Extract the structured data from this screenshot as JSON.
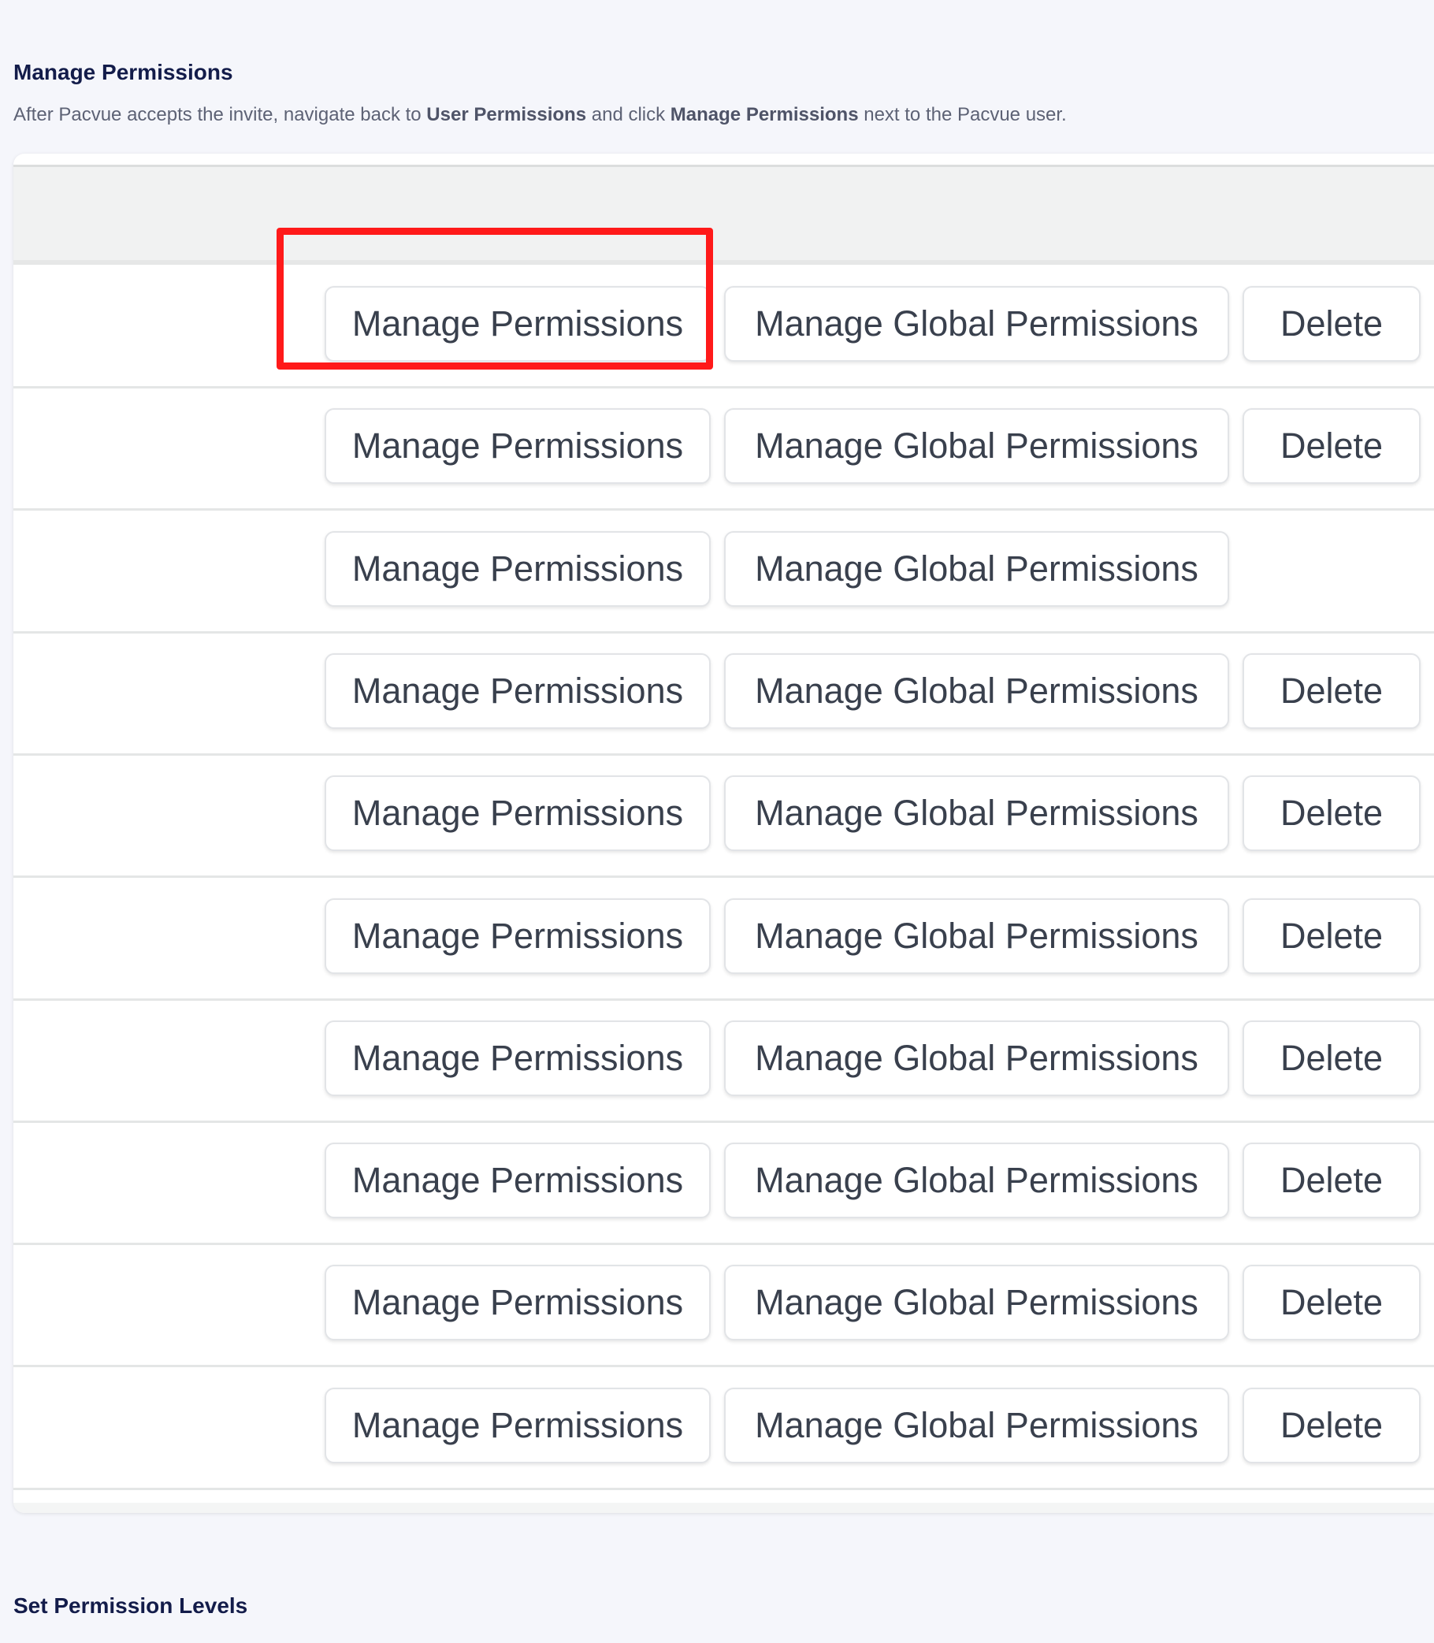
{
  "manage_section": {
    "title": "Manage Permissions",
    "intro_pre": "After Pacvue accepts the invite, navigate back to ",
    "intro_bold1": "User Permissions",
    "intro_mid": " and click ",
    "intro_bold2": "Manage Permissions",
    "intro_post": " next to the Pacvue user."
  },
  "table": {
    "rows": [
      {
        "manage_label": "Manage Permissions",
        "global_label": "Manage Global Permissions",
        "delete_label": "Delete",
        "highlighted": true
      },
      {
        "manage_label": "Manage Permissions",
        "global_label": "Manage Global Permissions",
        "delete_label": "Delete"
      },
      {
        "manage_label": "Manage Permissions",
        "global_label": "Manage Global Permissions"
      },
      {
        "manage_label": "Manage Permissions",
        "global_label": "Manage Global Permissions",
        "delete_label": "Delete"
      },
      {
        "manage_label": "Manage Permissions",
        "global_label": "Manage Global Permissions",
        "delete_label": "Delete"
      },
      {
        "manage_label": "Manage Permissions",
        "global_label": "Manage Global Permissions",
        "delete_label": "Delete"
      },
      {
        "manage_label": "Manage Permissions",
        "global_label": "Manage Global Permissions",
        "delete_label": "Delete"
      },
      {
        "manage_label": "Manage Permissions",
        "global_label": "Manage Global Permissions",
        "delete_label": "Delete"
      },
      {
        "manage_label": "Manage Permissions",
        "global_label": "Manage Global Permissions",
        "delete_label": "Delete"
      },
      {
        "manage_label": "Manage Permissions",
        "global_label": "Manage Global Permissions",
        "delete_label": "Delete"
      }
    ]
  },
  "highlight_color": "#ff1a1a",
  "levels_section": {
    "title": "Set Permission Levels"
  }
}
